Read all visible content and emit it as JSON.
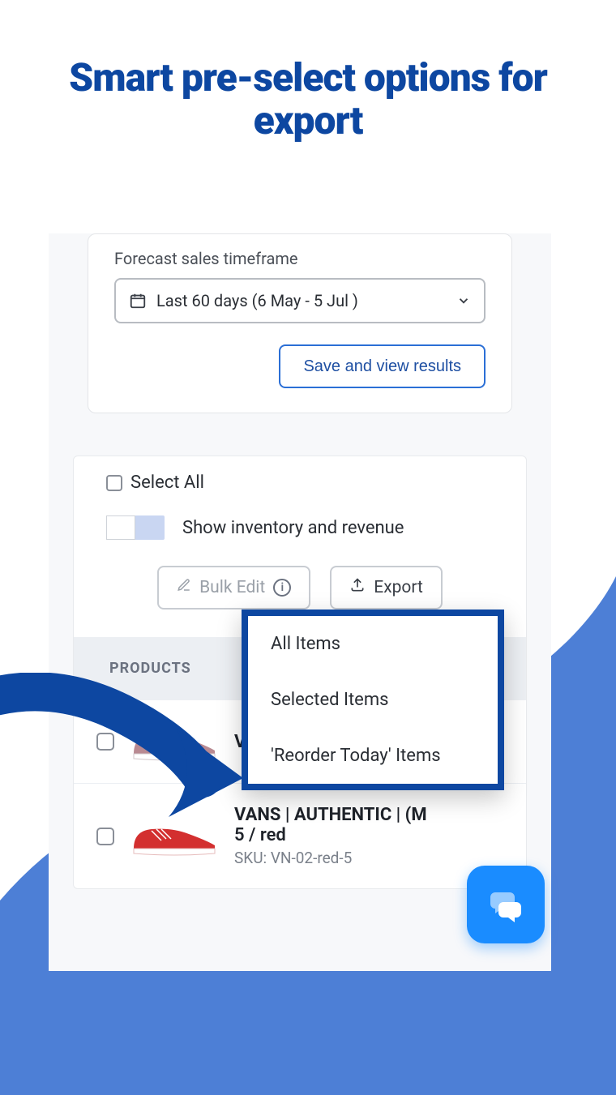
{
  "headline": "Smart pre-select options for export",
  "forecast": {
    "label": "Forecast sales timeframe",
    "selected": "Last 60 days (6 May - 5 Jul )",
    "save_button": "Save and view results"
  },
  "list": {
    "select_all": "Select All",
    "toggle_label": "Show inventory and revenue",
    "bulk_edit": "Bulk Edit",
    "export": "Export",
    "column_header": "PRODUCTS"
  },
  "dropdown": {
    "items": [
      "All Items",
      "Selected Items",
      "'Reorder Today' Items"
    ]
  },
  "products": [
    {
      "title": "VANS | AUTHENTIC LO |",
      "variant": "",
      "sku": ""
    },
    {
      "title": "VANS | AUTHENTIC | (M",
      "variant": "5 / red",
      "sku": "SKU: VN-02-red-5"
    }
  ]
}
